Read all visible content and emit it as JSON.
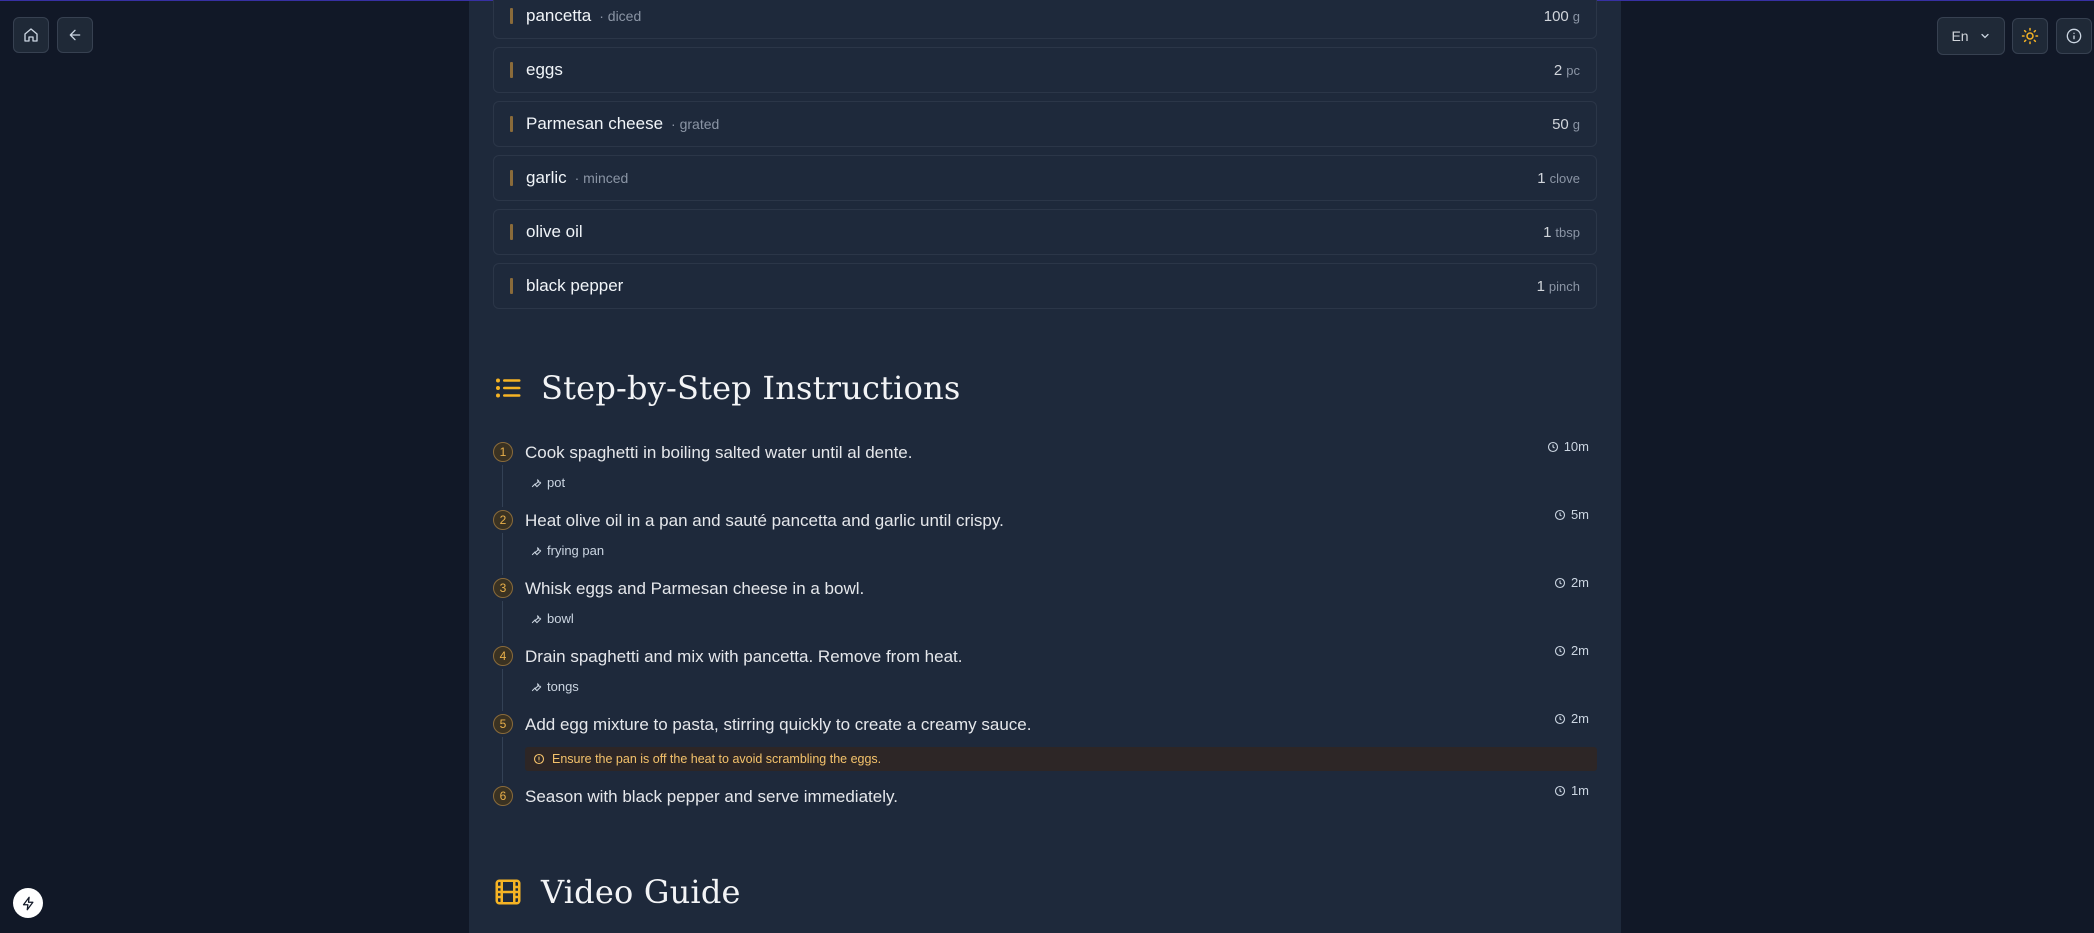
{
  "header": {
    "language": "En"
  },
  "ingredients": [
    {
      "name": "pancetta",
      "note": "· diced",
      "qty": "100",
      "unit": "g"
    },
    {
      "name": "eggs",
      "note": "",
      "qty": "2",
      "unit": "pc"
    },
    {
      "name": "Parmesan cheese",
      "note": "· grated",
      "qty": "50",
      "unit": "g"
    },
    {
      "name": "garlic",
      "note": "· minced",
      "qty": "1",
      "unit": "clove"
    },
    {
      "name": "olive oil",
      "note": "",
      "qty": "1",
      "unit": "tbsp"
    },
    {
      "name": "black pepper",
      "note": "",
      "qty": "1",
      "unit": "pinch"
    }
  ],
  "instructions": {
    "title": "Step-by-Step Instructions",
    "steps": [
      {
        "num": "1",
        "text": "Cook spaghetti in boiling salted water until al dente.",
        "time": "10m",
        "tool": "pot"
      },
      {
        "num": "2",
        "text": "Heat olive oil in a pan and sauté pancetta and garlic until crispy.",
        "time": "5m",
        "tool": "frying pan"
      },
      {
        "num": "3",
        "text": "Whisk eggs and Parmesan cheese in a bowl.",
        "time": "2m",
        "tool": "bowl"
      },
      {
        "num": "4",
        "text": "Drain spaghetti and mix with pancetta. Remove from heat.",
        "time": "2m",
        "tool": "tongs"
      },
      {
        "num": "5",
        "text": "Add egg mixture to pasta, stirring quickly to create a creamy sauce.",
        "time": "2m",
        "warning": "Ensure the pan is off the heat to avoid scrambling the eggs."
      },
      {
        "num": "6",
        "text": "Season with black pepper and serve immediately.",
        "time": "1m"
      }
    ]
  },
  "video": {
    "title": "Video Guide"
  },
  "colors": {
    "accent": "#f5b324",
    "background": "#111827",
    "panel": "#1e293b"
  }
}
